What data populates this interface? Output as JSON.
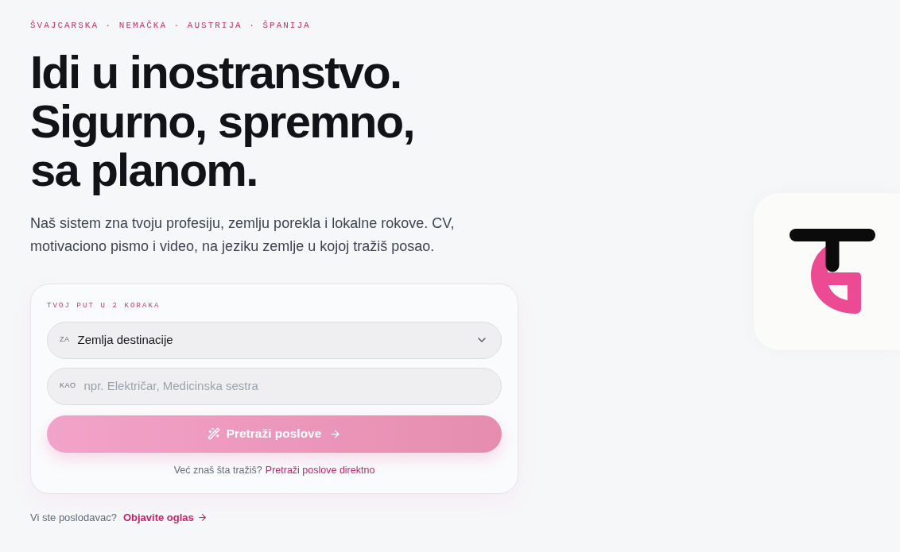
{
  "hero": {
    "countries": "ŠVAJCARSKA · NEMAČKA · AUSTRIJA · ŠPANIJA",
    "headline": [
      "Idi u inostranstvo.",
      "Sigurno, spremno,",
      "sa planom."
    ],
    "intro": [
      "Naš sistem zna tvoju profesiju, zemlju porekla i lokalne rokove. CV,",
      "motivaciono pismo i video, na jeziku zemlje u kojoj tražiš posao."
    ]
  },
  "search_card": {
    "label": "TVOJ PUT U 2 KORAKA",
    "destination": {
      "prefix": "ZA",
      "value": "Zemlja destinacije"
    },
    "occupation": {
      "prefix": "KAO",
      "placeholder": "npr. Električar, Medicinska sestra"
    },
    "submit": "Pretraži poslove",
    "hint": "Već znaš šta tražiš?",
    "hint_link": "Pretraži poslove direktno"
  },
  "employer": {
    "question": "Vi ste poslodavac?",
    "link": "Objavite oglas"
  }
}
